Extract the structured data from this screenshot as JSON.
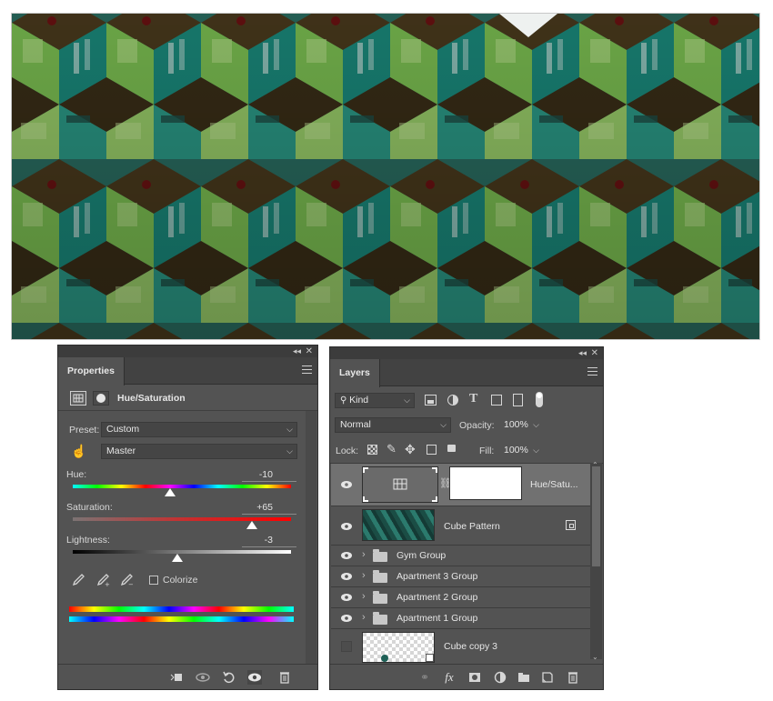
{
  "canvas": {
    "description_colors": {
      "teal": "#1f8d7e",
      "green": "#74b84c",
      "dark_floor": "#3e3219"
    }
  },
  "properties": {
    "tab_label": "Properties",
    "adjustment_title": "Hue/Saturation",
    "preset_label": "Preset:",
    "preset_value": "Custom",
    "channel_value": "Master",
    "hue_label": "Hue:",
    "hue_value": "-10",
    "saturation_label": "Saturation:",
    "saturation_value": "+65",
    "lightness_label": "Lightness:",
    "lightness_value": "-3",
    "colorize_label": "Colorize",
    "colorize_checked": false,
    "hue_slider": {
      "min": -180,
      "max": 180,
      "value": -10
    },
    "saturation_slider": {
      "min": -100,
      "max": 100,
      "value": 65
    },
    "lightness_slider": {
      "min": -100,
      "max": 100,
      "value": -3
    }
  },
  "layers": {
    "tab_label": "Layers",
    "kind_label": "Kind",
    "blend_mode": "Normal",
    "opacity_label": "Opacity:",
    "opacity_value": "100%",
    "lock_label": "Lock:",
    "fill_label": "Fill:",
    "fill_value": "100%",
    "items": [
      {
        "name": "Hue/Satu...",
        "type": "adjustment",
        "visible": true,
        "selected": true
      },
      {
        "name": "Cube Pattern",
        "type": "pattern",
        "visible": true,
        "selected": false
      },
      {
        "name": "Gym Group",
        "type": "group",
        "visible": true,
        "selected": false
      },
      {
        "name": "Apartment 3 Group",
        "type": "group",
        "visible": true,
        "selected": false
      },
      {
        "name": "Apartment 2 Group",
        "type": "group",
        "visible": true,
        "selected": false
      },
      {
        "name": "Apartment 1 Group",
        "type": "group",
        "visible": true,
        "selected": false
      },
      {
        "name": "Cube copy 3",
        "type": "smart-object",
        "visible": false,
        "selected": false
      }
    ]
  }
}
